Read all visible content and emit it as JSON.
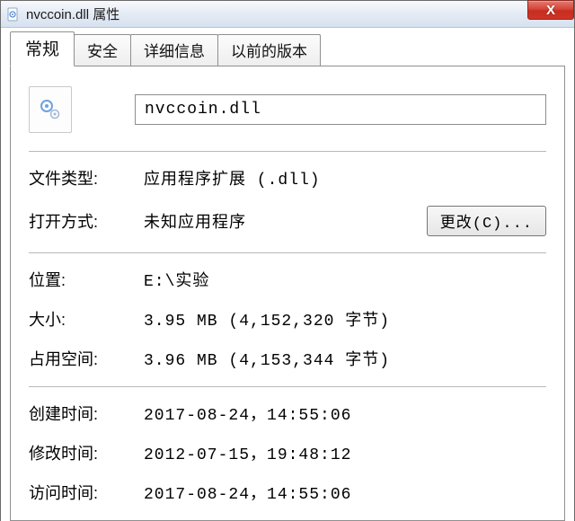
{
  "window": {
    "title": "nvccoin.dll 属性",
    "close_glyph": "X"
  },
  "tabs": {
    "general": "常规",
    "security": "安全",
    "details": "详细信息",
    "previous": "以前的版本"
  },
  "file": {
    "name": "nvccoin.dll"
  },
  "labels": {
    "filetype": "文件类型:",
    "openwith": "打开方式:",
    "location": "位置:",
    "size": "大小:",
    "ondisk": "占用空间:",
    "created": "创建时间:",
    "modified": "修改时间:",
    "accessed": "访问时间:"
  },
  "values": {
    "filetype": "应用程序扩展 (.dll)",
    "openwith": "未知应用程序",
    "location": "E:\\实验",
    "size": "3.95 MB (4,152,320 字节)",
    "ondisk": "3.96 MB (4,153,344 字节)",
    "created": "2017-08-24，14:55:06",
    "modified": "2012-07-15，19:48:12",
    "accessed": "2017-08-24，14:55:06"
  },
  "buttons": {
    "change": "更改(C)..."
  }
}
